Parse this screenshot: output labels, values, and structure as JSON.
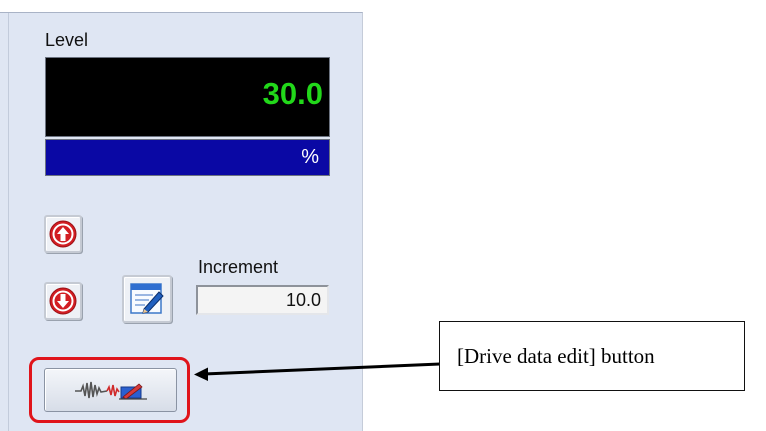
{
  "level": {
    "label": "Level",
    "value": "30.0",
    "unit": "%",
    "value_color": "#22d81a",
    "display_bg": "#000000",
    "unit_bar_bg": "#0a08a4"
  },
  "controls": {
    "up_icon": "arrow-up-circle-icon",
    "down_icon": "arrow-down-circle-icon",
    "edit_icon": "pencil-edit-icon"
  },
  "increment": {
    "label": "Increment",
    "value": "10.0"
  },
  "drive_data_edit": {
    "icon": "waveform-edit-icon",
    "highlight_color": "#e0141b"
  },
  "callout": {
    "text": "[Drive data edit] button"
  }
}
